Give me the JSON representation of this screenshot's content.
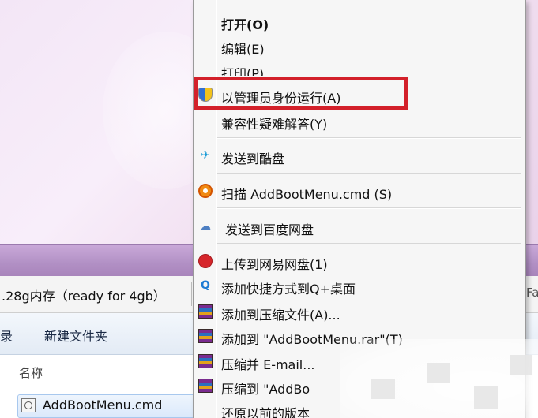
{
  "window": {
    "info_text": ".28g内存（ready for 4gb）",
    "info_tail": "Fa",
    "toolbar_partial": "录",
    "toolbar_new_folder": "新建文件夹",
    "column_name": "名称",
    "file_name": "AddBootMenu.cmd"
  },
  "menu": {
    "items": [
      {
        "label": "打开(O)"
      },
      {
        "label": "编辑(E)"
      },
      {
        "label": "打印(P)"
      },
      {
        "label": "以管理员身份运行(A)"
      },
      {
        "label": "兼容性疑难解答(Y)"
      },
      {
        "label": "发送到酷盘"
      },
      {
        "label": "扫描 AddBootMenu.cmd (S)"
      },
      {
        "label": "发送到百度网盘"
      },
      {
        "label": "上传到网易网盘(1)"
      },
      {
        "label": "添加快捷方式到Q+桌面"
      },
      {
        "label": "添加到压缩文件(A)..."
      },
      {
        "label": "添加到 \"AddBootMenu.rar\"(T)"
      },
      {
        "label": "压缩并 E-mail..."
      },
      {
        "label": "压缩到 \"AddBo"
      },
      {
        "label": "还原以前的版本"
      }
    ]
  },
  "colors": {
    "highlight_border": "#d3202a",
    "menu_background": "#f6f6f6"
  }
}
